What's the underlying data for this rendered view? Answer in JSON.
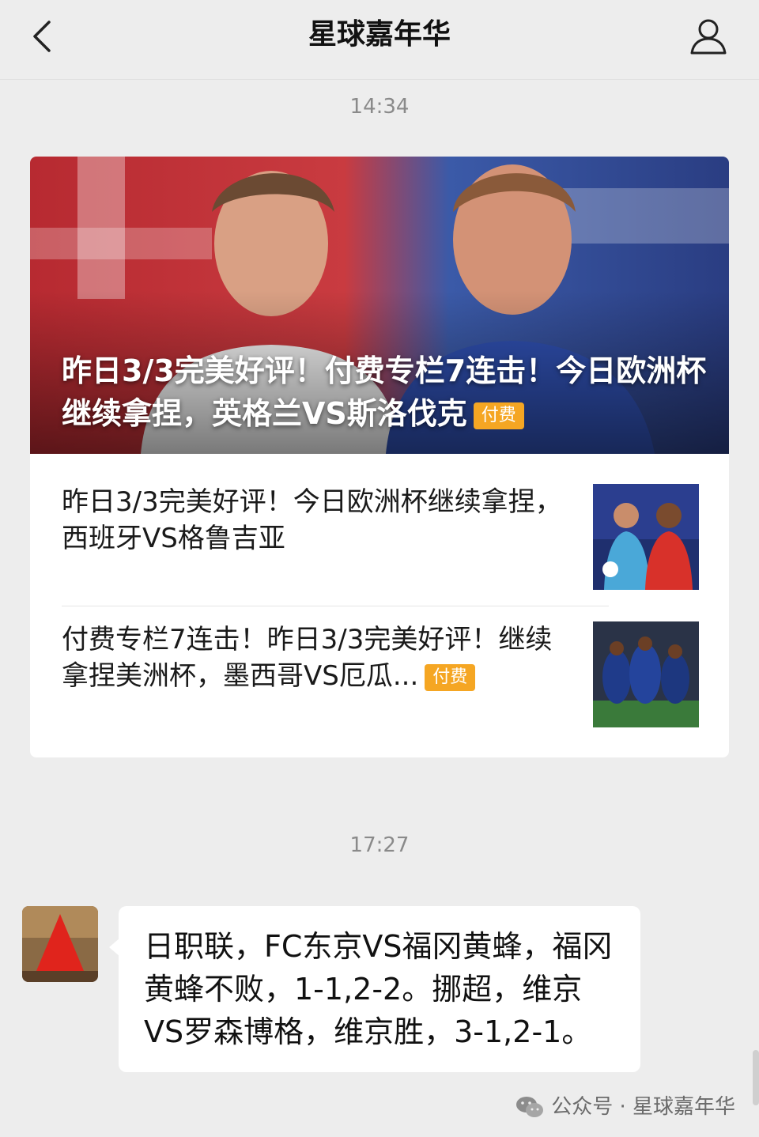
{
  "nav": {
    "title": "星球嘉年华",
    "back_icon": "chevron-left-icon",
    "profile_icon": "person-icon"
  },
  "messages": [
    {
      "time": "14:34",
      "article_card": {
        "hero": {
          "title": "昨日3/3完美好评！付费专栏7连击！今日欧洲杯继续拿捏，英格兰VS斯洛伐克",
          "tag": "付费"
        },
        "items": [
          {
            "title": "昨日3/3完美好评！今日欧洲杯继续拿捏，西班牙VS格鲁吉亚",
            "tag": ""
          },
          {
            "title": "付费专栏7连击！昨日3/3完美好评！继续拿捏美洲杯，墨西哥VS厄瓜...",
            "tag": "付费"
          }
        ]
      }
    },
    {
      "time": "17:27",
      "text_message": {
        "text": "日职联，FC东京VS福冈黄蜂，福冈黄蜂不败，1-1,2-2。挪超，维京VS罗森博格，维京胜，3-1,2-1。"
      }
    }
  ],
  "watermark": {
    "text": "公众号 · 星球嘉年华",
    "icon": "wechat-icon"
  },
  "colors": {
    "background": "#ededed",
    "tag": "#f5a623",
    "timestamp": "#8a8a8a"
  }
}
